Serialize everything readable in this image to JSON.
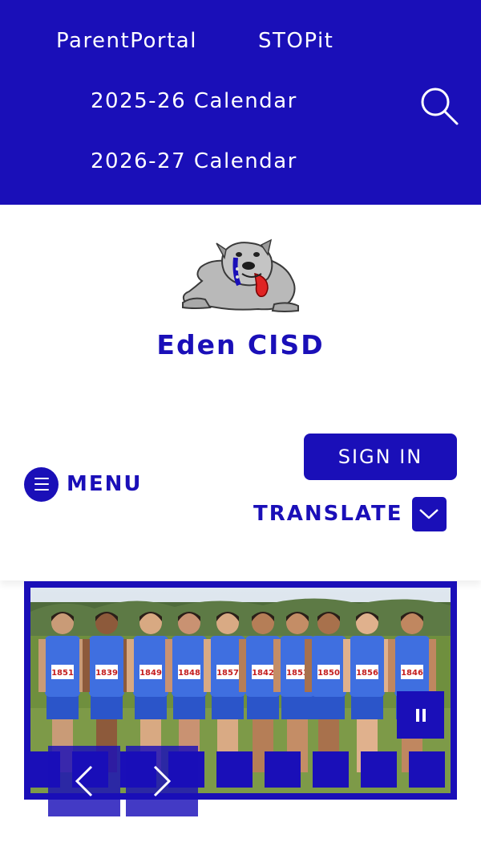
{
  "top_links": [
    "ParentPortal",
    "STOPit",
    "2025-26 Calendar",
    "2026-27 Calendar"
  ],
  "icons": {
    "search": "search-icon",
    "menu": "hamburger-icon",
    "translate": "chevron-down-icon",
    "pause": "pause-icon",
    "prev": "chevron-left-icon",
    "next": "chevron-right-icon"
  },
  "header": {
    "site_name": "Eden CISD",
    "logo": "bulldog-logo"
  },
  "actions": {
    "menu_label": "MENU",
    "sign_in_label": "SIGN IN",
    "translate_label": "TRANSLATE"
  },
  "slideshow": {
    "bib_numbers": [
      "1851",
      "1839",
      "1849",
      "1848",
      "1857",
      "1842",
      "1853",
      "1850",
      "1856",
      "1846"
    ],
    "dot_count": 9,
    "active_dot": 1
  },
  "colors": {
    "brand_blue": "#1a0fb8",
    "white": "#ffffff"
  }
}
